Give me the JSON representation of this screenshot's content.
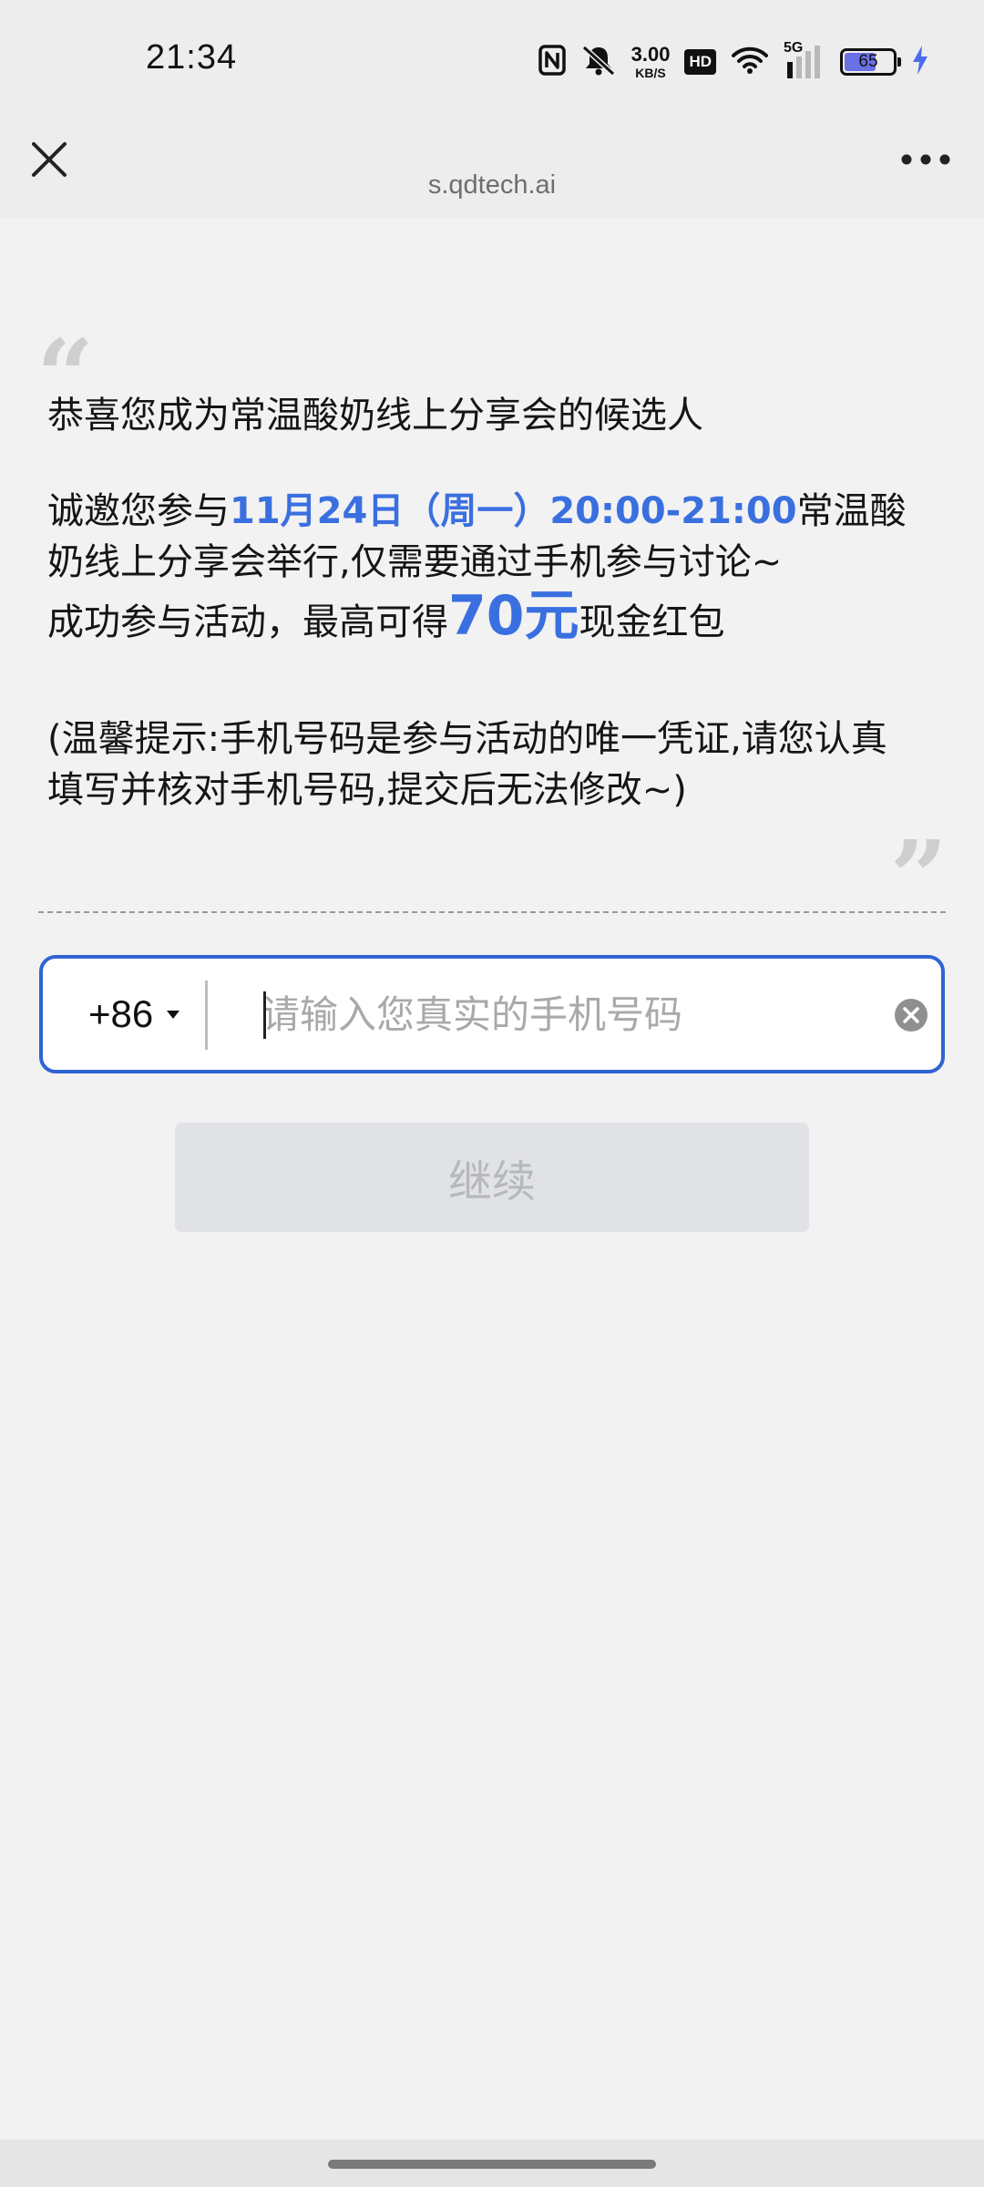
{
  "status_bar": {
    "time": "21:34",
    "net_speed_value": "3.00",
    "net_speed_unit": "KB/S",
    "hd_label": "HD",
    "signal_label": "5G",
    "battery_level": "65",
    "battery_fraction": 0.65,
    "icons": [
      "nfc-icon",
      "mute-icon",
      "wifi-icon",
      "signal-icon",
      "battery-icon",
      "charging-icon"
    ]
  },
  "title_bar": {
    "url": "s.qdtech.ai",
    "close_icon": "close-icon",
    "more_icon": "more-icon"
  },
  "message": {
    "line1": "恭喜您成为常温酸奶线上分享会的候选人",
    "line2_prefix": "诚邀您参与",
    "line2_date": "11月24日（周一）20:00-21:00",
    "line2_suffix": "常温酸奶线上分享会举行,仅需要通过手机参与讨论~",
    "line3_prefix": "成功参与活动，最高可得",
    "line3_amount": "70元",
    "line3_suffix": "现金红包",
    "line4": "(温馨提示:手机号码是参与活动的唯一凭证,请您认真填写并核对手机号码,提交后无法修改~)"
  },
  "form": {
    "country_code": "+86",
    "phone_placeholder": "请输入您真实的手机号码",
    "phone_value": "",
    "continue_label": "继续"
  },
  "colors": {
    "accent": "#3a6fe0",
    "input_border": "#2f64d2",
    "disabled_button": "#e1e2e6",
    "battery_fill": "#6a70e6",
    "charging": "#4a6cf0"
  }
}
